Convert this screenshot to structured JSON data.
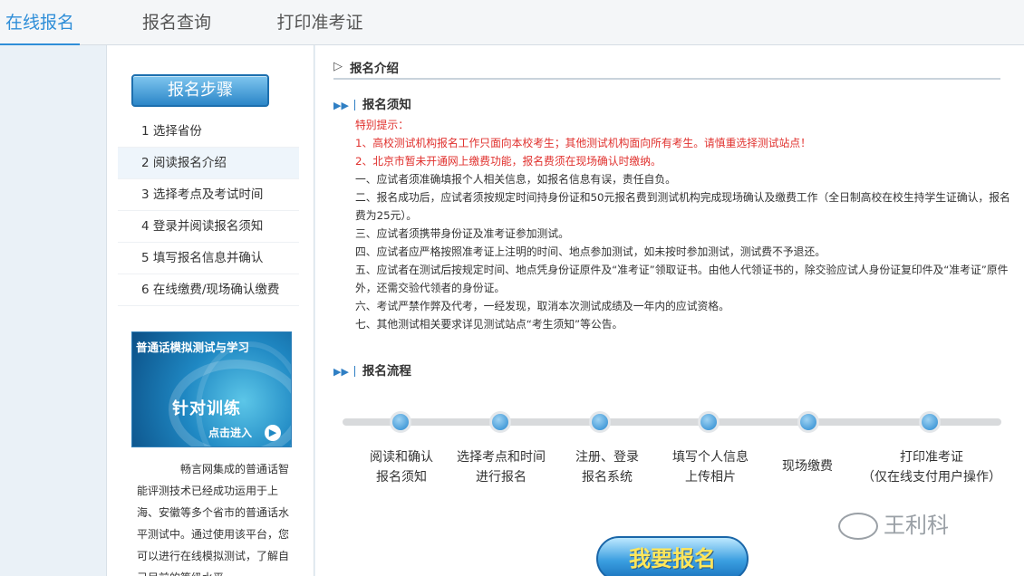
{
  "tabs": [
    {
      "label": "在线报名"
    },
    {
      "label": "报名查询"
    },
    {
      "label": "打印准考证"
    }
  ],
  "sidebar": {
    "steps_button": "报名步骤",
    "steps": [
      {
        "label": "1 选择省份"
      },
      {
        "label": "2 阅读报名介绍"
      },
      {
        "label": "3 选择考点及考试时间"
      },
      {
        "label": "4 登录并阅读报名须知"
      },
      {
        "label": "5 填写报名信息并确认"
      },
      {
        "label": "6 在线缴费/现场确认缴费"
      }
    ],
    "promo": {
      "title": "普通话模拟测试与学习",
      "main": "针对训练",
      "enter": "点击进入"
    },
    "description": "畅言网集成的普通话智能评测技术已经成功运用于上海、安徽等多个省市的普通话水平测试中。通过使用该平台，您可以进行在线模拟测试，了解自己目前的等级水平"
  },
  "main": {
    "section_title": "报名介绍",
    "notice_title": "报名须知",
    "notice": {
      "tip_label": "特别提示：",
      "red1": "1、高校测试机构报名工作只面向本校考生；其他测试机构面向所有考生。请慎重选择测试站点！",
      "red2": "2、北京市暂未开通网上缴费功能，报名费须在现场确认时缴纳。",
      "items": [
        "一、应试者须准确填报个人相关信息，如报名信息有误，责任自负。",
        "二、报名成功后，应试者须按规定时间持身份证和50元报名费到测试机构完成现场确认及缴费工作（全日制高校在校生持学生证确认，报名费为25元）。",
        "三、应试者须携带身份证及准考证参加测试。",
        "四、应试者应严格按照准考证上注明的时间、地点参加测试，如未按时参加测试，测试费不予退还。",
        "五、应试者在测试后按规定时间、地点凭身份证原件及“准考证”领取证书。由他人代领证书的，除交验应试人身份证复印件及“准考证”原件外，还需交验代领者的身份证。",
        "六、考试严禁作弊及代考，一经发现，取消本次测试成绩及一年内的应试资格。",
        "七、其他测试相关要求详见测试站点“考生须知”等公告。"
      ]
    },
    "flow_title": "报名流程",
    "flow_steps": [
      {
        "line1": "阅读和确认",
        "line2": "报名须知"
      },
      {
        "line1": "选择考点和时间",
        "line2": "进行报名"
      },
      {
        "line1": "注册、登录",
        "line2": "报名系统"
      },
      {
        "line1": "填写个人信息",
        "line2": "上传相片"
      },
      {
        "line1": "现场缴费",
        "line2": ""
      },
      {
        "line1": "打印准考证",
        "line2": "（仅在线支付用户操作）"
      }
    ],
    "apply_button": "我要报名"
  },
  "watermark": "王利科"
}
